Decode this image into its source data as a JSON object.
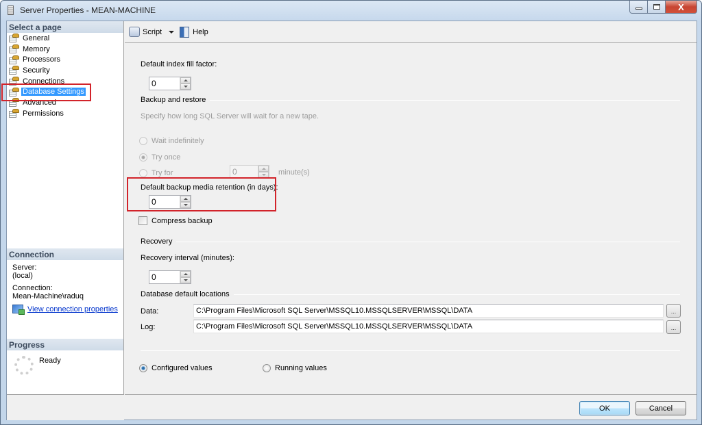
{
  "window": {
    "title": "Server Properties - MEAN-MACHINE",
    "icon": "server-icon",
    "controls": {
      "minimize": "minimize-icon",
      "maximize": "maximize-icon",
      "close": "close-icon",
      "close_glyph": "X"
    }
  },
  "sidebar": {
    "header": "Select a page",
    "items": [
      {
        "label": "General",
        "icon": "page-settings-icon"
      },
      {
        "label": "Memory",
        "icon": "page-settings-icon"
      },
      {
        "label": "Processors",
        "icon": "page-settings-icon"
      },
      {
        "label": "Security",
        "icon": "page-settings-icon"
      },
      {
        "label": "Connections",
        "icon": "page-settings-icon"
      },
      {
        "label": "Database Settings",
        "icon": "page-settings-icon",
        "selected": true
      },
      {
        "label": "Advanced",
        "icon": "page-settings-icon"
      },
      {
        "label": "Permissions",
        "icon": "page-settings-icon"
      }
    ]
  },
  "connection": {
    "header": "Connection",
    "server_label": "Server:",
    "server_value": "(local)",
    "connection_label": "Connection:",
    "connection_value": "Mean-Machine\\raduq",
    "link": "View connection properties"
  },
  "progress": {
    "header": "Progress",
    "status": "Ready"
  },
  "toolbar": {
    "script_label": "Script",
    "help_label": "Help"
  },
  "settings": {
    "fill_factor_label": "Default index fill factor:",
    "fill_factor_value": "0",
    "backup_group": "Backup and restore",
    "backup_desc": "Specify how long SQL Server will wait for a new tape.",
    "wait_indefinitely": "Wait indefinitely",
    "try_once": "Try once",
    "try_for": "Try for",
    "try_for_value": "0",
    "try_for_unit": "minute(s)",
    "retention_label": "Default backup media retention (in days):",
    "retention_value": "0",
    "compress_label": "Compress backup",
    "compress_checked": false,
    "recovery_group": "Recovery",
    "recovery_label": "Recovery interval (minutes):",
    "recovery_value": "0",
    "locations_group": "Database default locations",
    "data_label": "Data:",
    "data_path": "C:\\Program Files\\Microsoft SQL Server\\MSSQL10.MSSQLSERVER\\MSSQL\\DATA",
    "log_label": "Log:",
    "log_path": "C:\\Program Files\\Microsoft SQL Server\\MSSQL10.MSSQLSERVER\\MSSQL\\DATA",
    "browse_label": "...",
    "configured_values": "Configured values",
    "running_values": "Running values",
    "selected_mode": "configured"
  },
  "buttons": {
    "ok": "OK",
    "cancel": "Cancel"
  },
  "colors": {
    "highlight": "#d2232a",
    "selection": "#3399ff",
    "link": "#0033cc"
  }
}
